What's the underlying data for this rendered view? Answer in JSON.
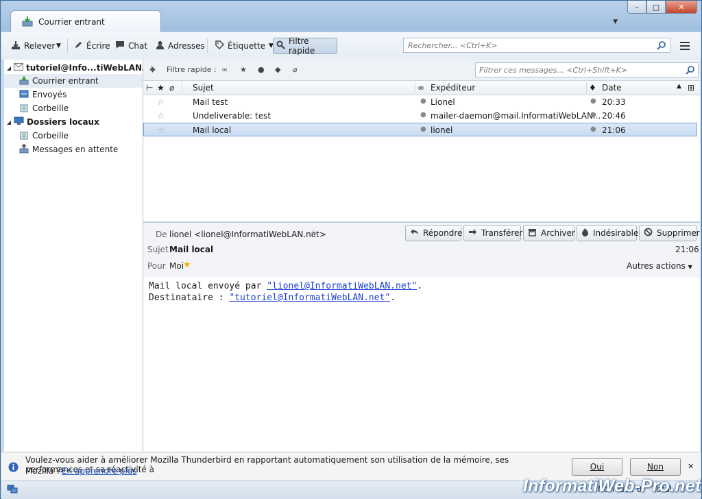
{
  "window": {
    "minimize": "–",
    "maximize": "□",
    "close": "✕"
  },
  "tab": {
    "label": "Courrier entrant"
  },
  "toolbar": {
    "relever": "Relever",
    "ecrire": "Écrire",
    "chat": "Chat",
    "adresses": "Adresses",
    "etiquette": "Étiquette",
    "filtre_rapide": "Filtre rapide",
    "search_placeholder": "Rechercher... <Ctrl+K>"
  },
  "folders": {
    "account": "tutoriel@Info...tiWebLAN.net",
    "items": [
      "Courrier entrant",
      "Envoyés",
      "Corbeille"
    ],
    "local": "Dossiers locaux",
    "local_items": [
      "Corbeille",
      "Messages en attente"
    ]
  },
  "quickfilter": {
    "label": "Filtre rapide :",
    "placeholder": "Filtrer ces messages... <Ctrl+Shift+K>"
  },
  "columns": {
    "subject": "Sujet",
    "sender": "Expéditeur",
    "date": "Date"
  },
  "messages": [
    {
      "subject": "Mail test",
      "sender": "Lionel",
      "date": "20:33"
    },
    {
      "subject": "Undeliverable: test",
      "sender": "mailer-daemon@mail.InformatiWebLAN...",
      "date": "20:46"
    },
    {
      "subject": "Mail local",
      "sender": "lionel",
      "date": "21:06"
    }
  ],
  "header": {
    "from_label": "De",
    "from": "lionel <lionel@InformatiWebLAN.net>",
    "subject_label": "Sujet",
    "subject": "Mail local",
    "time": "21:06",
    "to_label": "Pour",
    "to": "Moi",
    "reply": "Répondre",
    "forward": "Transférer",
    "archive": "Archiver",
    "junk": "Indésirable",
    "delete": "Supprimer",
    "other": "Autres actions"
  },
  "body": {
    "line1_pre": "Mail local envoyé par ",
    "line1_link": "\"lionel@InformatiWebLAN.net\"",
    "line1_post": ".",
    "line2_pre": "Destinataire : ",
    "line2_link": "\"tutoriel@InformatiWebLAN.net\"",
    "line2_post": "."
  },
  "notification": {
    "text1": "Voulez-vous aider à améliorer Mozilla Thunderbird en rapportant automatiquement son utilisation de la mémoire, ses performances et sa réactivité à",
    "text2": "Mozilla ?",
    "link": "En apprendre plus",
    "yes": "Oui",
    "no": "Non",
    "close": "✕"
  },
  "status": {
    "unread": "Non lus : 0",
    "total": "Total : 3"
  },
  "watermark": "InformatiWeb-Pro.net"
}
